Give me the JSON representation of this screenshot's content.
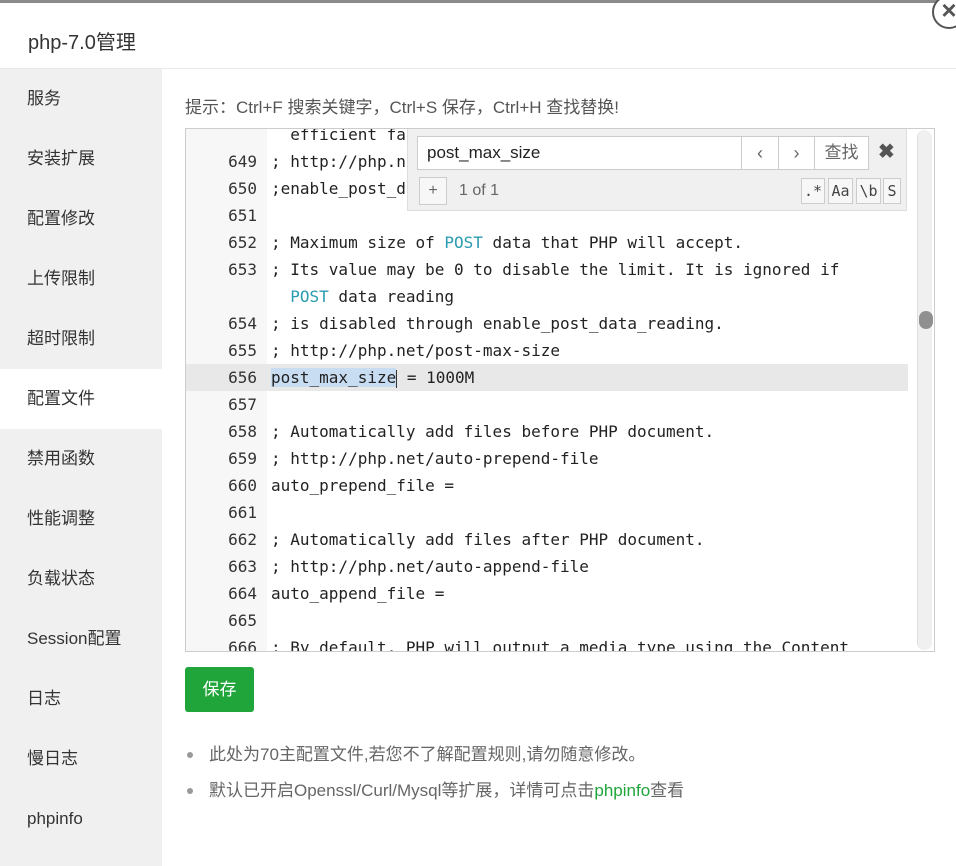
{
  "window": {
    "title": "php-7.0管理",
    "close_symbol": "×"
  },
  "sidebar": {
    "items": [
      {
        "label": "服务"
      },
      {
        "label": "安装扩展"
      },
      {
        "label": "配置修改"
      },
      {
        "label": "上传限制"
      },
      {
        "label": "超时限制"
      },
      {
        "label": "配置文件",
        "active": true
      },
      {
        "label": "禁用函数"
      },
      {
        "label": "性能调整"
      },
      {
        "label": "负载状态"
      },
      {
        "label": "Session配置"
      },
      {
        "label": "日志"
      },
      {
        "label": "慢日志"
      },
      {
        "label": "phpinfo"
      }
    ]
  },
  "main": {
    "hint": "提示：Ctrl+F 搜索关键字，Ctrl+S 保存，Ctrl+H 查找替换!",
    "editor": {
      "lines": [
        {
          "num": "",
          "text": "  efficient fa"
        },
        {
          "num": "649",
          "text": "; http://php.n"
        },
        {
          "num": "650",
          "text": ";enable_post_d"
        },
        {
          "num": "651",
          "text": ""
        },
        {
          "num": "652",
          "text_before": "; Maximum size of ",
          "kw": "POST",
          "text_after": " data that PHP will accept."
        },
        {
          "num": "653",
          "text": "; Its value may be 0 to disable the limit. It is ignored if"
        },
        {
          "num": "",
          "text_before": "  ",
          "kw": "POST",
          "text_after": " data reading"
        },
        {
          "num": "654",
          "text": "; is disabled through enable_post_data_reading."
        },
        {
          "num": "655",
          "text": "; http://php.net/post-max-size"
        },
        {
          "num": "656",
          "hl": "post_max_size",
          "text_after": " = 1000M",
          "active": true
        },
        {
          "num": "657",
          "text": ""
        },
        {
          "num": "658",
          "text": "; Automatically add files before PHP document."
        },
        {
          "num": "659",
          "text": "; http://php.net/auto-prepend-file"
        },
        {
          "num": "660",
          "text": "auto_prepend_file ="
        },
        {
          "num": "661",
          "text": ""
        },
        {
          "num": "662",
          "text": "; Automatically add files after PHP document."
        },
        {
          "num": "663",
          "text": "; http://php.net/auto-append-file"
        },
        {
          "num": "664",
          "text": "auto_append_file ="
        },
        {
          "num": "665",
          "text": ""
        },
        {
          "num": "666",
          "text": "; By default, PHP will output a media type using the Content"
        }
      ]
    },
    "search": {
      "value": "post_max_size",
      "prev_symbol": "‹",
      "next_symbol": "›",
      "find_label": "查找",
      "close_symbol": "✖",
      "plus_symbol": "+",
      "match_count": "1 of 1",
      "regex_label": ".*",
      "case_label": "Aa",
      "word_label": "\\b",
      "selection_label": "S"
    },
    "save_label": "保存",
    "notes": {
      "note1": "此处为70主配置文件,若您不了解配置规则,请勿随意修改。",
      "note2_prefix": "默认已开启Openssl/Curl/Mysql等扩展，详情可点击",
      "note2_link": "phpinfo",
      "note2_suffix": "查看"
    }
  },
  "colors": {
    "accent": "#20a53a",
    "keyword": "#2a9bb0",
    "highlight": "#c8dcf2"
  }
}
